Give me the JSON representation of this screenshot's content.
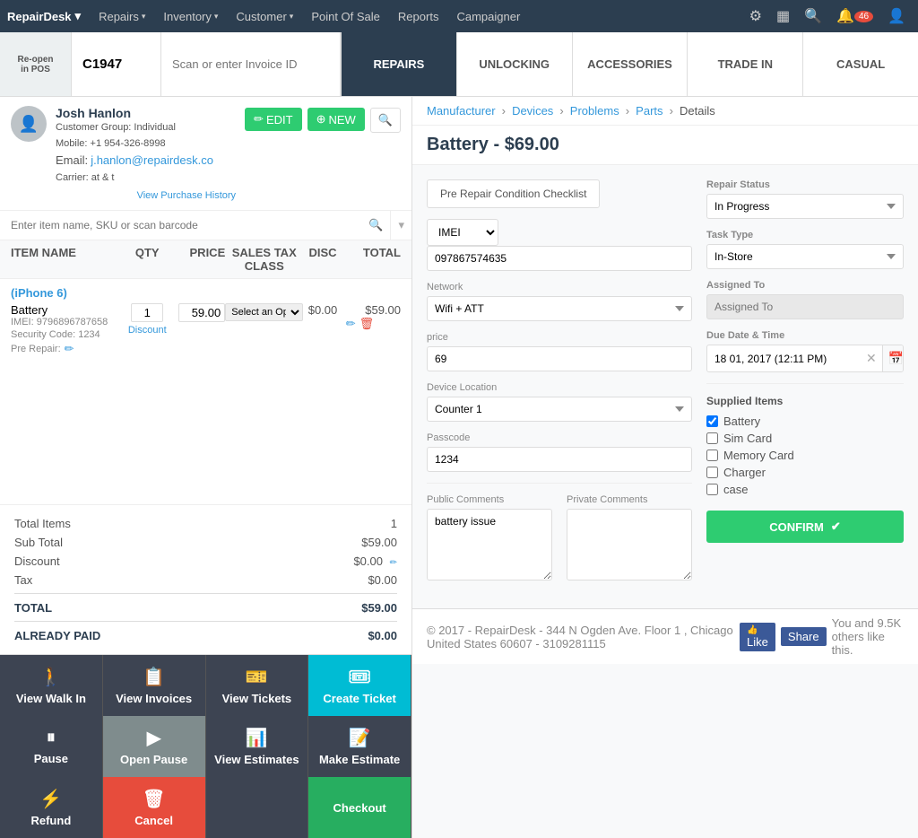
{
  "topnav": {
    "brand": "RepairDesk",
    "repairs": "Repairs",
    "inventory": "Inventory",
    "customer": "Customer",
    "pointofsale": "Point Of Sale",
    "reports": "Reports",
    "campaigner": "Campaigner",
    "notif_count": "46"
  },
  "second_row": {
    "reopen_label": "Re-open\nin POS",
    "invoice_id": "C1947",
    "invoice_search_placeholder": "Scan or enter Invoice ID",
    "tab_repairs": "REPAIRS",
    "tab_unlocking": "UNLOCKING",
    "tab_accessories": "ACCESSORIES",
    "tab_trade_in": "TRADE IN",
    "tab_casual": "CASUAL"
  },
  "customer": {
    "name": "Josh Hanlon",
    "group": "Customer Group: Individual",
    "mobile": "Mobile: +1 954-326-8998",
    "email": "Email:",
    "email_val": "j.hanlon@repairdesk.co",
    "carrier": "Carrier: at & t",
    "edit_label": "EDIT",
    "new_label": "NEW",
    "view_history": "View Purchase History"
  },
  "item_search_placeholder": "Enter item name, SKU or scan barcode",
  "table_headers": {
    "item_name": "ITEM NAME",
    "qty": "QTY",
    "price": "PRICE",
    "sales_tax_class": "SALES TAX CLASS",
    "disc": "DISC",
    "total": "TOTAL"
  },
  "items": [
    {
      "device_group": "(iPhone 6)",
      "name": "Battery",
      "imei_label": "IMEI:",
      "imei_val": "9796896787658",
      "security_label": "Security Code:",
      "security_val": "1234",
      "pre_repair_label": "Pre Repair:",
      "qty": "1",
      "price": "59.00",
      "discount_label": "Discount",
      "tax_option": "Select an Opti...",
      "disc_val": "$0.00",
      "total": "$59.00"
    }
  ],
  "totals": {
    "total_items_label": "Total Items",
    "total_items_val": "1",
    "subtotal_label": "Sub Total",
    "subtotal_val": "$59.00",
    "discount_label": "Discount",
    "discount_val": "$0.00",
    "tax_label": "Tax",
    "tax_val": "$0.00",
    "total_label": "TOTAL",
    "total_val": "$59.00",
    "already_paid_label": "ALREADY PAID",
    "already_paid_val": "$0.00"
  },
  "bottom_actions": {
    "view_walk_in": "View Walk In",
    "view_invoices": "View Invoices",
    "view_tickets": "View Tickets",
    "create_ticket": "Create Ticket",
    "pause": "Pause",
    "open_pause": "Open Pause",
    "view_estimates": "View Estimates",
    "make_estimate": "Make Estimate",
    "refund": "Refund",
    "cancel": "Cancel",
    "checkout": "Checkout"
  },
  "right_panel": {
    "breadcrumb": {
      "manufacturer": "Manufacturer",
      "devices": "Devices",
      "problems": "Problems",
      "parts": "Parts",
      "details": "Details"
    },
    "title": "Battery - $69.00",
    "pre_repair_btn": "Pre Repair Condition Checklist",
    "form": {
      "imei_label": "IMEI",
      "imei_option": "IMEI",
      "imei_val": "097867574635",
      "network_label": "Network",
      "network_val": "Wifi + ATT",
      "price_label": "price",
      "price_val": "69",
      "device_location_label": "Device Location",
      "device_location_val": "Counter 1",
      "passcode_label": "Passcode",
      "passcode_val": "1234",
      "public_comments_label": "Public Comments",
      "public_comments_val": "battery issue",
      "private_comments_label": "Private Comments",
      "private_comments_val": ""
    },
    "repair_status": {
      "label": "Repair Status",
      "val": "In Progress",
      "task_type_label": "Task Type",
      "task_type_val": "In-Store",
      "assigned_to_label": "Assigned To",
      "assigned_to_val": "",
      "due_date_label": "Due Date & Time",
      "due_date_val": "18 01, 2017 (12:11 PM)"
    },
    "supplied_items": {
      "title": "Supplied Items",
      "items": [
        {
          "label": "Battery",
          "checked": true
        },
        {
          "label": "Sim Card",
          "checked": false
        },
        {
          "label": "Memory Card",
          "checked": false
        },
        {
          "label": "Charger",
          "checked": false
        },
        {
          "label": "case",
          "checked": false
        }
      ]
    },
    "confirm_btn": "CONFIRM"
  },
  "footer": {
    "copy": "© 2017 - RepairDesk - 344 N Ogden Ave. Floor 1 , Chicago United States 60607 - 3109281115",
    "like_label": "Like",
    "share_label": "Share",
    "social_text": "You and 9.5K others like this."
  }
}
